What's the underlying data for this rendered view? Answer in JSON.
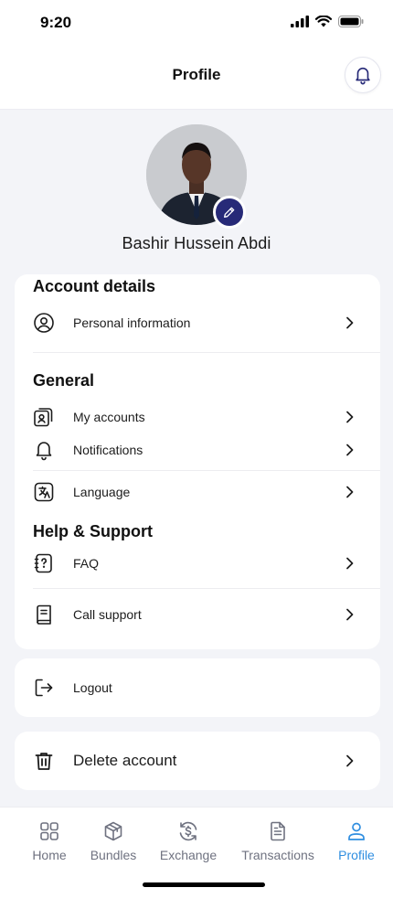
{
  "status_bar": {
    "time": "9:20"
  },
  "header": {
    "title": "Profile"
  },
  "profile": {
    "name": "Bashir Hussein Abdi"
  },
  "sections": {
    "account_details": {
      "title": "Account details",
      "items": [
        {
          "label": "Personal information",
          "icon": "user-circle-icon"
        }
      ]
    },
    "general": {
      "title": "General",
      "items": [
        {
          "label": "My accounts",
          "icon": "accounts-icon"
        },
        {
          "label": "Notifications",
          "icon": "bell-icon"
        },
        {
          "label": "Language",
          "icon": "translate-icon"
        }
      ]
    },
    "help_support": {
      "title": "Help & Support",
      "items": [
        {
          "label": "FAQ",
          "icon": "faq-icon"
        },
        {
          "label": "Call support",
          "icon": "call-support-icon"
        }
      ]
    }
  },
  "logout": {
    "label": "Logout"
  },
  "delete_account": {
    "label": "Delete account"
  },
  "bottom_nav": {
    "items": [
      {
        "label": "Home",
        "icon": "home-grid-icon"
      },
      {
        "label": "Bundles",
        "icon": "box-icon"
      },
      {
        "label": "Exchange",
        "icon": "exchange-icon"
      },
      {
        "label": "Transactions",
        "icon": "document-icon"
      },
      {
        "label": "Profile",
        "icon": "person-icon"
      }
    ],
    "active": "Profile"
  },
  "colors": {
    "accent": "#272a78",
    "nav_active": "#2f8ee0",
    "background": "#f3f4f8"
  }
}
